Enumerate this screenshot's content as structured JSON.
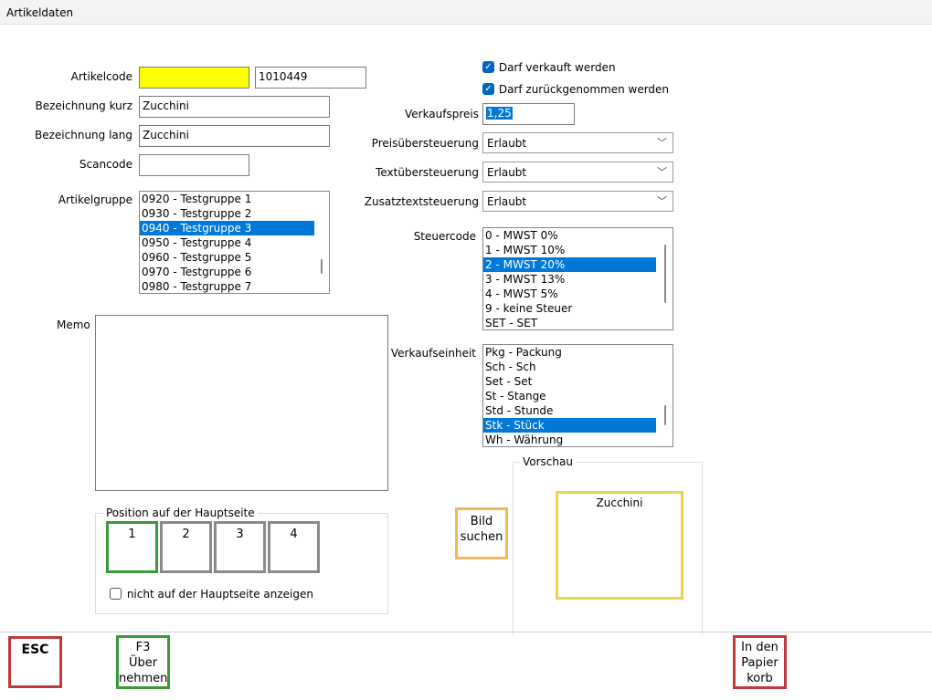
{
  "window": {
    "title": "Artikeldaten"
  },
  "form": {
    "artikelcode_label": "Artikelcode",
    "artikelcode_value": "",
    "artikelnummer": "1010449",
    "bez_kurz_label": "Bezeichnung kurz",
    "bez_kurz_value": "Zucchini",
    "bez_lang_label": "Bezeichnung lang",
    "bez_lang_value": "Zucchini",
    "scancode_label": "Scancode",
    "scancode_value": "",
    "artikelgruppe_label": "Artikelgruppe",
    "artikelgruppen": [
      "0920 - Testgruppe 1",
      "0930 - Testgruppe 2",
      "0940 - Testgruppe 3",
      "0950 - Testgruppe 4",
      "0960 - Testgruppe 5",
      "0970 - Testgruppe 6",
      "0980 - Testgruppe 7"
    ],
    "memo_label": "Memo",
    "memo_value": ""
  },
  "right": {
    "darf_verkauft": "Darf verkauft werden",
    "darf_zurueck": "Darf zurückgenommen werden",
    "verkaufspreis_label": "Verkaufspreis",
    "verkaufspreis_value": "1,25",
    "preis_label": "Preisübersteuerung",
    "preis_value": "Erlaubt",
    "text_label": "Textübersteuerung",
    "text_value": "Erlaubt",
    "zusatz_label": "Zusatztextsteuerung",
    "zusatz_value": "Erlaubt",
    "steuercode_label": "Steuercode",
    "steuercodes": [
      "0 - MWST 0%",
      "1 - MWST 10%",
      "2 - MWST 20%",
      "3 - MWST 13%",
      "4 - MWST 5%",
      "9 - keine Steuer",
      "SET - SET"
    ],
    "verkaufseinheit_label": "Verkaufseinheit",
    "verkaufseinheiten": [
      "Pkg - Packung",
      "Sch - Sch",
      "Set - Set",
      "St - Stange",
      "Std - Stunde",
      "Stk - Stück",
      "Wh - Währung"
    ]
  },
  "position": {
    "title": "Position auf der Hauptseite",
    "buttons": [
      "1",
      "2",
      "3",
      "4"
    ],
    "hide_label": "nicht auf der Hauptseite anzeigen"
  },
  "preview": {
    "title": "Vorschau",
    "bild_btn_line1": "Bild",
    "bild_btn_line2": "suchen",
    "tile_text": "Zucchini"
  },
  "footer": {
    "esc": "ESC",
    "f3_line1": "F3",
    "f3_line2": "Über",
    "f3_line3": "nehmen",
    "papier_line1": "In den",
    "papier_line2": "Papier",
    "papier_line3": "korb"
  },
  "colors": {
    "selection": "#0078d7",
    "yellow": "#ffff00",
    "green_border": "#3a9a3a",
    "red_border": "#c03a3a",
    "orange_border": "#f0b95a",
    "preview_border": "#e8d54a"
  }
}
